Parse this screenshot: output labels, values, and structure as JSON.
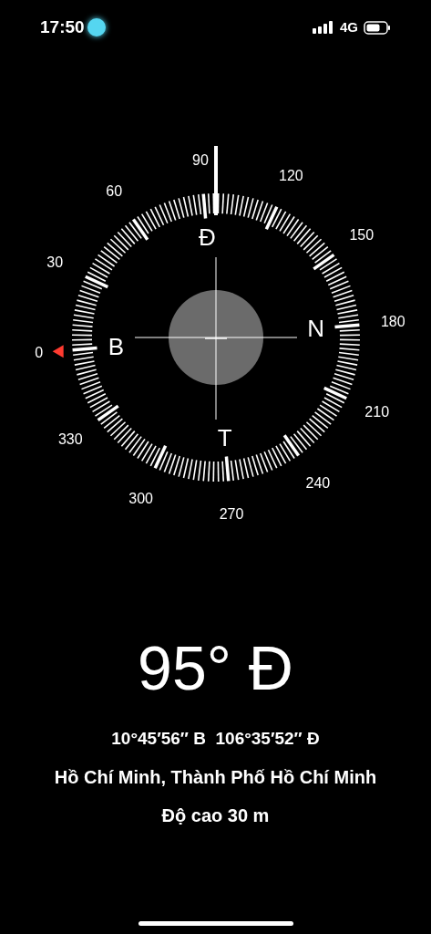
{
  "status_bar": {
    "time": "17:50",
    "network": "4G"
  },
  "compass": {
    "degree_labels": [
      "0",
      "30",
      "60",
      "90",
      "120",
      "150",
      "180",
      "210",
      "240",
      "270",
      "300",
      "330"
    ],
    "cardinal_labels": [
      "Đ",
      "N",
      "T",
      "B"
    ]
  },
  "heading": "95° Đ",
  "coordinates": "10°45′56″ B  106°35′52″ Đ",
  "place": "Hồ Chí Minh, Thành Phố Hồ Chí Minh",
  "altitude": "Độ cao 30 m"
}
